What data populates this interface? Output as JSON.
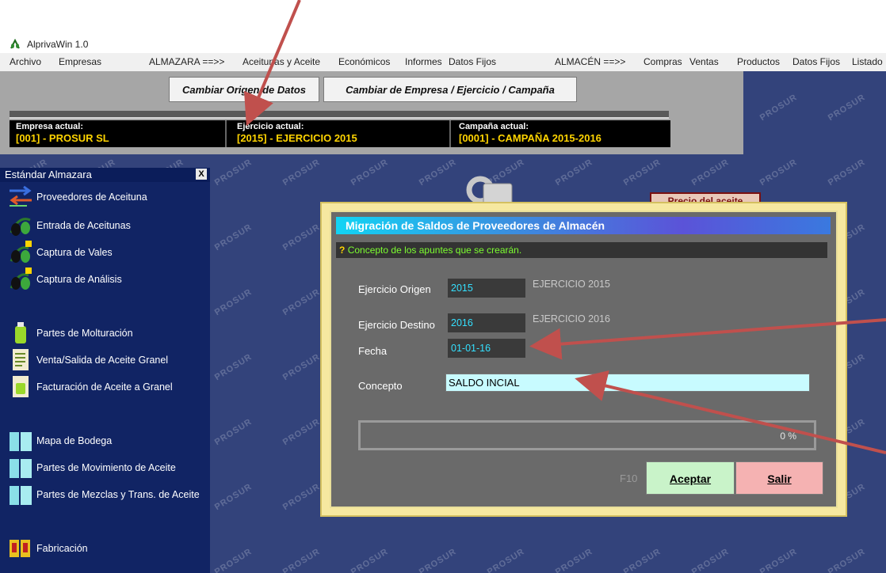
{
  "window": {
    "title": "AlprivaWin 1.0"
  },
  "menubar": {
    "items": [
      "Archivo",
      "Empresas",
      "ALMAZARA ==>>",
      "Aceitunas y Aceite",
      "Económicos",
      "Informes",
      "Datos Fijos",
      "ALMACÉN ==>>",
      "Compras",
      "Ventas",
      "Productos",
      "Datos Fijos",
      "Listado"
    ]
  },
  "toolbar": {
    "cambiar_origen": "Cambiar Origen de Datos",
    "cambiar_empresa": "Cambiar de Empresa / Ejercicio / Campaña"
  },
  "info": {
    "empresa_label": "Empresa actual:",
    "empresa_value": "[001] - PROSUR SL",
    "ejercicio_label": "Ejercicio actual:",
    "ejercicio_value": "[2015] - EJERCICIO 2015",
    "campana_label": "Campaña actual:",
    "campana_value": "[0001] - CAMPAÑA 2015-2016"
  },
  "sidebar": {
    "header": "Estándar Almazara",
    "close": "X",
    "items": [
      {
        "label": "Proveedores de Aceituna"
      },
      {
        "label": "Entrada de Aceitunas"
      },
      {
        "label": "Captura de Vales"
      },
      {
        "label": "Captura de Análisis"
      },
      {
        "label": "Partes de Molturación"
      },
      {
        "label": "Venta/Salida de Aceite Granel"
      },
      {
        "label": "Facturación de Aceite a Granel"
      },
      {
        "label": "Mapa de Bodega"
      },
      {
        "label": "Partes de Movimiento de Aceite"
      },
      {
        "label": "Partes de Mezclas y Trans. de Aceite"
      },
      {
        "label": "Fabricación"
      }
    ]
  },
  "background": {
    "precio": "Precio del aceite",
    "watermark": "PROSUR"
  },
  "dialog": {
    "title": "Migración de Saldos de Proveedores de Almacén",
    "hint": "Concepto de los apuntes que se crearán.",
    "ejercicio_origen_label": "Ejercicio Origen",
    "ejercicio_origen_value": "2015",
    "ejercicio_origen_desc": "EJERCICIO 2015",
    "ejercicio_destino_label": "Ejercicio Destino",
    "ejercicio_destino_value": "2016",
    "ejercicio_destino_desc": "EJERCICIO 2016",
    "fecha_label": "Fecha",
    "fecha_value": "01-01-16",
    "concepto_label": "Concepto",
    "concepto_value": "SALDO INCIAL",
    "progress_percent": 0,
    "progress_text": "0 %",
    "f10": "F10",
    "aceptar": "Aceptar",
    "salir": "Salir"
  },
  "colors": {
    "desktop": "#33437b",
    "panel": "#112464",
    "dialog": "#6a6a6a",
    "arrow": "#c0504d"
  }
}
